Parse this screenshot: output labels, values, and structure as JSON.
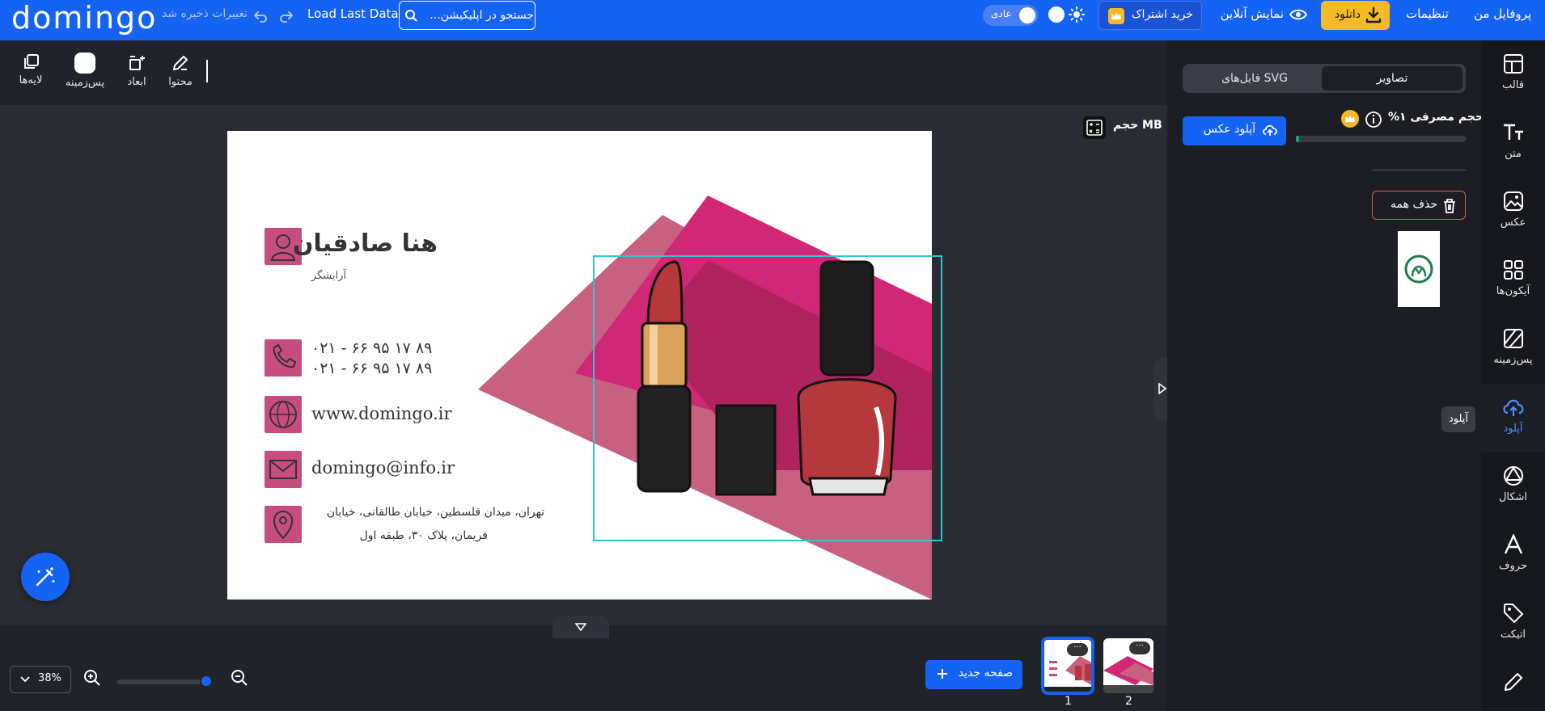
{
  "header": {
    "logo": "domingo",
    "save_status": "تغییرات ذخیره شد",
    "load_last": "Load Last Data",
    "search_placeholder": "جستجو در اپلیکیشن...",
    "mode_label": "عادی",
    "buy_subscription": "خرید اشتراک",
    "online_preview": "نمایش آنلاین",
    "download": "دانلود",
    "settings": "تنظیمات",
    "profile": "پروفایل من"
  },
  "toolbar": {
    "layers": "لایه‌ها",
    "background": "پس‌زمینه",
    "dimensions": "ابعاد",
    "content": "محتوا"
  },
  "canvas": {
    "size_label": "حجم MB",
    "card": {
      "name": "هنا صادقیان",
      "title": "آرایشگر",
      "phone_1": "۰۲۱ - ۶۶ ۹۵ ۱۷ ۸۹",
      "phone_2": "۰۲۱ - ۶۶ ۹۵ ۱۷ ۸۹",
      "website": "www.domingo.ir",
      "email": "domingo@info.ir",
      "address_line_1": "تهران، میدان فلسطین، خیابان طالقانی، خیابان",
      "address_line_2": "فریمان، پلاک ۳۰، طبقه اول",
      "accent_color": "#c74d81"
    }
  },
  "bottom": {
    "zoom": "38%",
    "zoom_level": 0.95,
    "new_page": "صفحه جدید",
    "pages": [
      "1",
      "2"
    ],
    "page_menu": "···"
  },
  "panel": {
    "tab_images": "تصاویر",
    "tab_svg": "فایل‌های SVG",
    "upload_button": "آپلود عکس",
    "usage_label": "حجم مصرفی ۱%",
    "usage_percent": 1,
    "delete_all": "حذف همه"
  },
  "sidebar": {
    "items": [
      {
        "label": "قالب",
        "icon": "template-icon"
      },
      {
        "label": "متن",
        "icon": "text-icon"
      },
      {
        "label": "عکس",
        "icon": "photo-icon"
      },
      {
        "label": "آیکون‌ها",
        "icon": "icons-grid-icon"
      },
      {
        "label": "پس‌زمینه",
        "icon": "background-icon"
      },
      {
        "label": "آپلود",
        "icon": "cloud-upload-icon"
      },
      {
        "label": "اشکال",
        "icon": "shapes-icon"
      },
      {
        "label": "حروف",
        "icon": "letters-icon"
      },
      {
        "label": "اتیکت",
        "icon": "tag-icon"
      },
      {
        "label": "",
        "icon": "pencil-icon"
      }
    ],
    "tooltip": "آپلود"
  },
  "colors": {
    "brand_blue": "#1463f3",
    "download_yellow": "#f7b928",
    "dark_bg": "#2a2c33",
    "selection_cyan": "#32c3d6"
  }
}
